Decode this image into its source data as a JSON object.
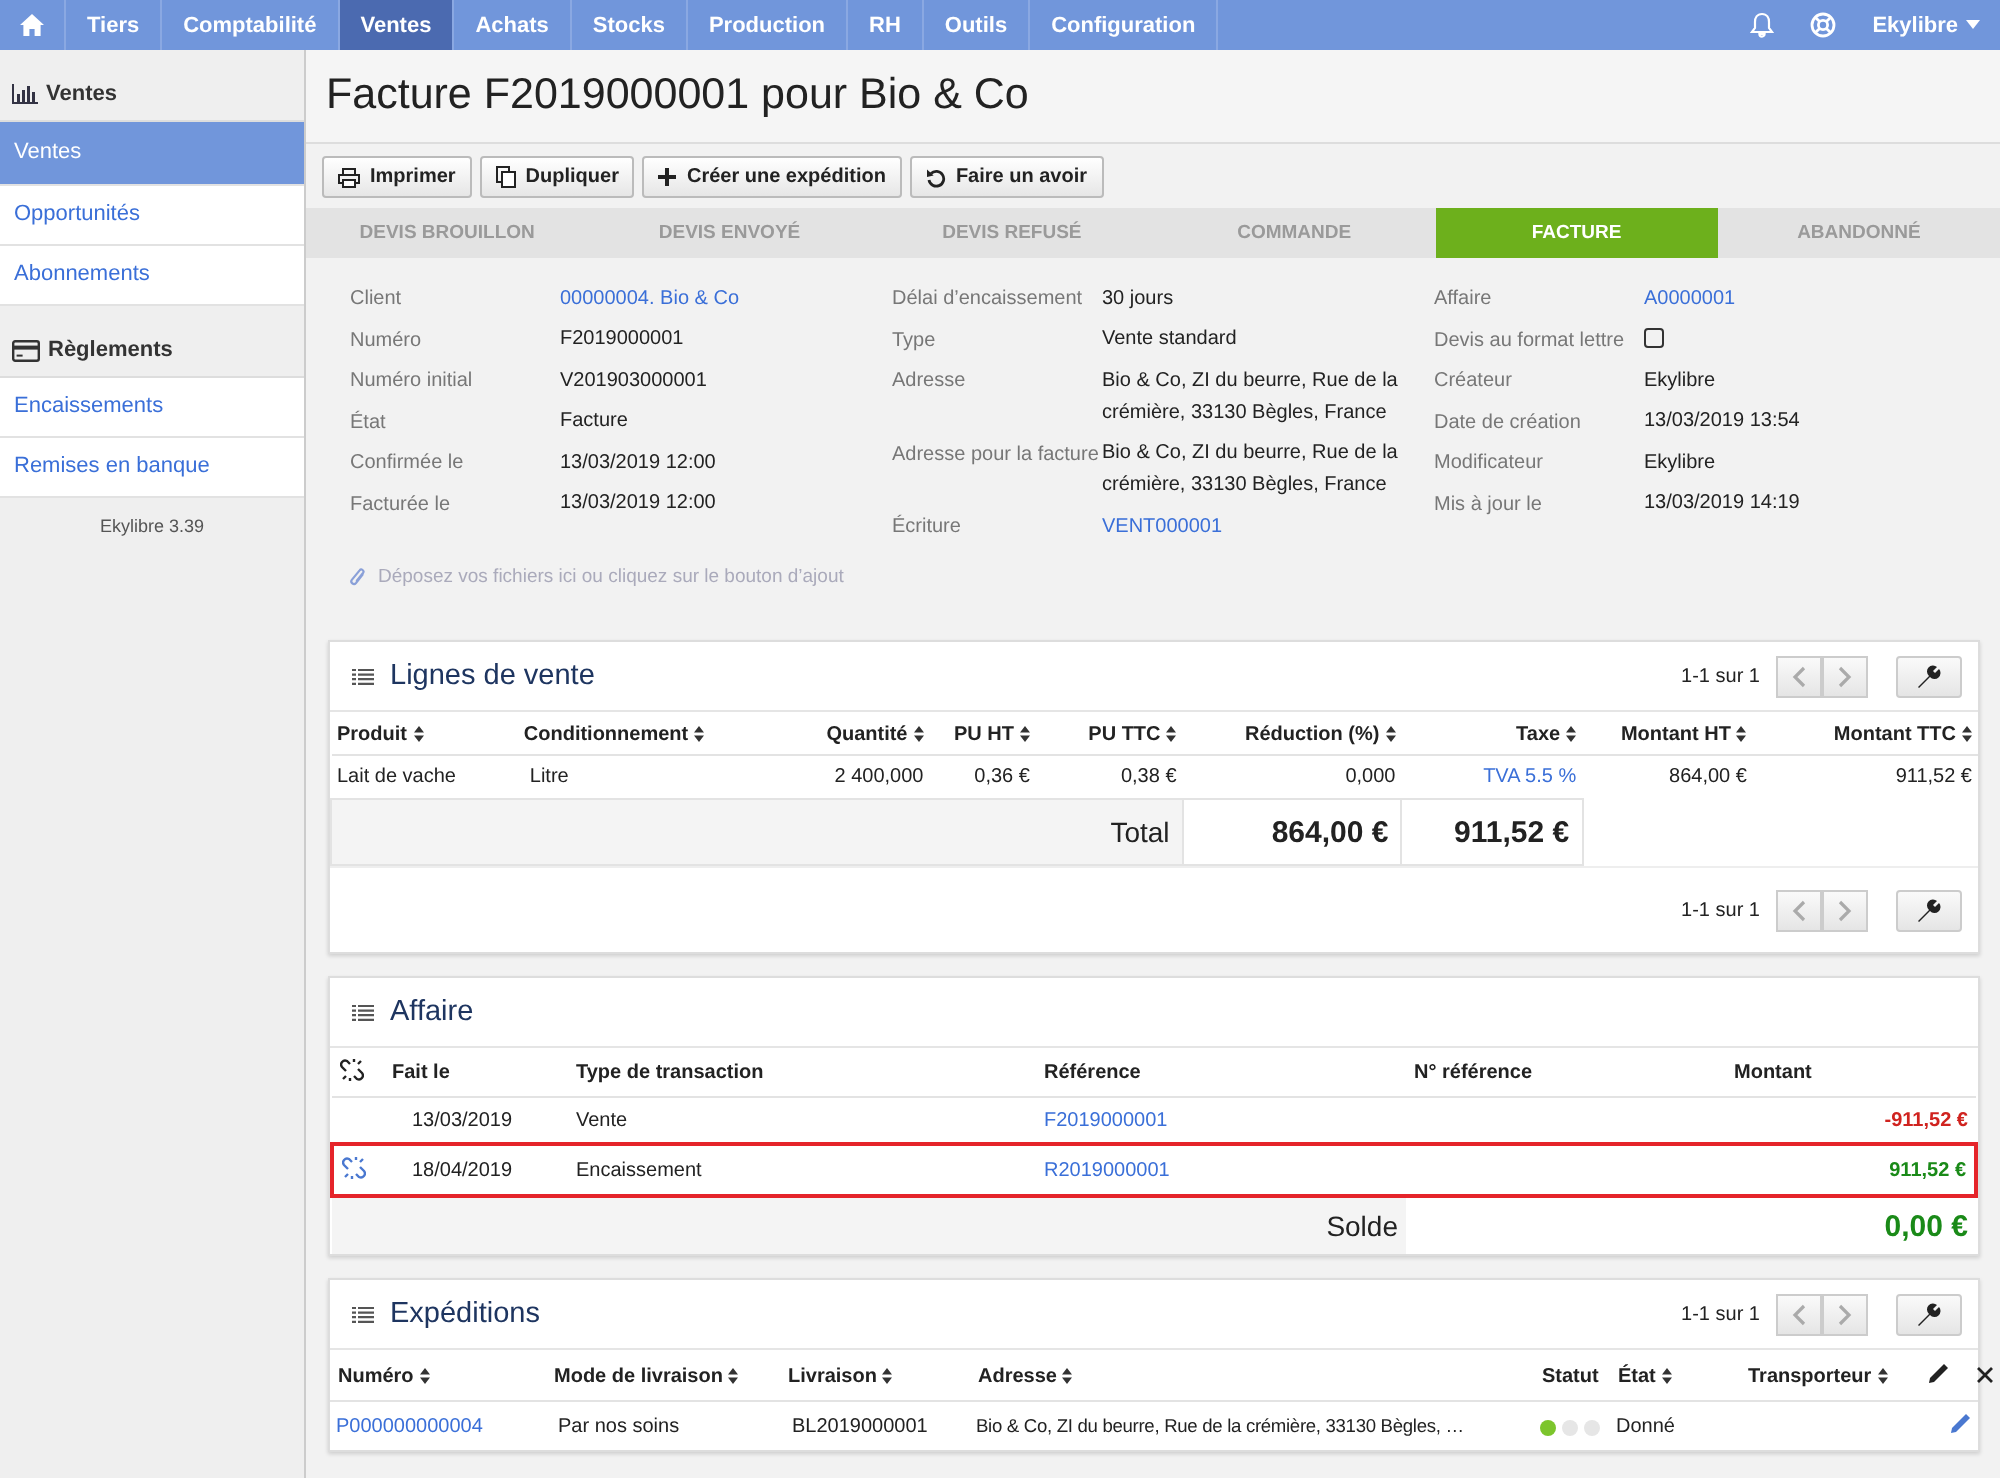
{
  "topnav": {
    "items": [
      {
        "label": "Tiers",
        "selected": false
      },
      {
        "label": "Comptabilité",
        "selected": false
      },
      {
        "label": "Ventes",
        "selected": true
      },
      {
        "label": "Achats",
        "selected": false
      },
      {
        "label": "Stocks",
        "selected": false
      },
      {
        "label": "Production",
        "selected": false
      },
      {
        "label": "RH",
        "selected": false
      },
      {
        "label": "Outils",
        "selected": false
      },
      {
        "label": "Configuration",
        "selected": false
      }
    ],
    "user": "Ekylibre"
  },
  "sidebar": {
    "sections": [
      {
        "title": "Ventes",
        "items": [
          {
            "label": "Ventes",
            "selected": true
          },
          {
            "label": "Opportunités",
            "selected": false
          },
          {
            "label": "Abonnements",
            "selected": false
          }
        ]
      },
      {
        "title": "Règlements",
        "items": [
          {
            "label": "Encaissements",
            "selected": false
          },
          {
            "label": "Remises en banque",
            "selected": false
          }
        ]
      }
    ],
    "version": "Ekylibre 3.39"
  },
  "page_title": "Facture F2019000001 pour Bio & Co",
  "actions": [
    {
      "label": "Imprimer"
    },
    {
      "label": "Dupliquer"
    },
    {
      "label": "Créer une expédition"
    },
    {
      "label": "Faire un avoir"
    }
  ],
  "steps": [
    {
      "label": "DEVIS BROUILLON",
      "selected": false
    },
    {
      "label": "DEVIS ENVOYÉ",
      "selected": false
    },
    {
      "label": "DEVIS REFUSÉ",
      "selected": false
    },
    {
      "label": "COMMANDE",
      "selected": false
    },
    {
      "label": "FACTURE",
      "selected": true
    },
    {
      "label": "ABANDONNÉ",
      "selected": false
    }
  ],
  "details": [
    [
      {
        "label": "Client",
        "value": "00000004. Bio & Co",
        "kind": "link"
      },
      {
        "label": "Numéro",
        "value": "F2019000001",
        "kind": "text"
      },
      {
        "label": "Numéro initial",
        "value": "V201903000001",
        "kind": "text"
      },
      {
        "label": "État",
        "value": "Facture",
        "kind": "text"
      },
      {
        "label": "Confirmée le",
        "value": "13/03/2019 12:00",
        "kind": "text"
      },
      {
        "label": "Facturée le",
        "value": "13/03/2019 12:00",
        "kind": "text"
      }
    ],
    [
      {
        "label": "Délai d’encaissement",
        "value": "30 jours",
        "kind": "text"
      },
      {
        "label": "Type",
        "value": "Vente standard",
        "kind": "text"
      },
      {
        "label": "Adresse",
        "value": "Bio & Co, ZI du beurre, Rue de la crémière, 33130 Bègles, France",
        "kind": "text"
      },
      {
        "label": "Adresse pour la facture",
        "value": "Bio & Co, ZI du beurre, Rue de la crémière, 33130 Bègles, France",
        "kind": "text"
      },
      {
        "label": "Écriture",
        "value": "VENT000001",
        "kind": "link"
      }
    ],
    [
      {
        "label": "Affaire",
        "value": "A0000001",
        "kind": "link"
      },
      {
        "label": "Devis au format lettre",
        "kind": "checkbox",
        "checked": false
      },
      {
        "label": "Créateur",
        "value": "Ekylibre",
        "kind": "text"
      },
      {
        "label": "Date de création",
        "value": "13/03/2019 13:54",
        "kind": "text"
      },
      {
        "label": "Modificateur",
        "value": "Ekylibre",
        "kind": "text"
      },
      {
        "label": "Mis à jour le",
        "value": "13/03/2019 14:19",
        "kind": "text"
      }
    ]
  ],
  "dropzone": "Déposez vos fichiers ici ou cliquez sur le bouton d’ajout",
  "sale_lines": {
    "title": "Lignes de vente",
    "pagination": "1-1 sur 1",
    "pagination_bottom": "1-1 sur 1",
    "columns": [
      "Produit",
      "Conditionnement",
      "Quantité",
      "PU HT",
      "PU TTC",
      "Réduction (%)",
      "Taxe",
      "Montant HT",
      "Montant TTC"
    ],
    "rows": [
      {
        "cells": [
          "Lait de vache",
          "Litre",
          "2 400,000",
          "0,36 €",
          "0,38 €",
          "0,000",
          "TVA 5.5 %",
          "864,00 €",
          "911,52 €"
        ]
      }
    ],
    "total": {
      "label": "Total",
      "pretax": "864,00 €",
      "with_tax": "911,52 €"
    }
  },
  "affair": {
    "title": "Affaire",
    "columns": [
      "Fait le",
      "Type de transaction",
      "Référence",
      "N° référence",
      "Montant"
    ],
    "rows": [
      {
        "date": "13/03/2019",
        "type": "Vente",
        "reference": "F2019000001",
        "amount": "-911,52 €",
        "color": "#d0231f",
        "reconciled": false,
        "highlighted": false
      },
      {
        "date": "18/04/2019",
        "type": "Encaissement",
        "reference": "R2019000001",
        "amount": "911,52 €",
        "color": "#1a8a18",
        "reconciled": true,
        "highlighted": true
      }
    ],
    "balance": {
      "label": "Solde",
      "value": "0,00 €",
      "color": "#1a8a18"
    }
  },
  "shipments": {
    "title": "Expéditions",
    "pagination": "1-1 sur 1",
    "columns": [
      {
        "label": "Numéro",
        "sortable": true
      },
      {
        "label": "Mode de livraison",
        "sortable": true
      },
      {
        "label": "Livraison",
        "sortable": true
      },
      {
        "label": "Adresse",
        "sortable": true
      },
      {
        "label": "Statut",
        "sortable": false
      },
      {
        "label": "État",
        "sortable": true
      },
      {
        "label": "Transporteur",
        "sortable": true
      }
    ],
    "rows": [
      {
        "number": "P000000000004",
        "mode": "Par nos soins",
        "delivery": "BL2019000001",
        "address": "Bio & Co, ZI du beurre, Rue de la crémière, 33130 Bègles, …",
        "status": [
          {
            "on": true
          },
          {
            "on": false
          },
          {
            "on": false
          }
        ],
        "state": "Donné"
      }
    ]
  }
}
